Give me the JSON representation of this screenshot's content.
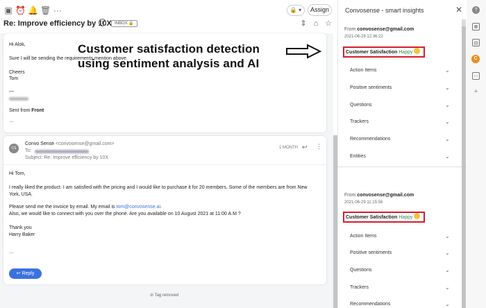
{
  "toolbar": {
    "lock_label": "🔒 ▾",
    "assign_label": "Assign"
  },
  "conversation": {
    "subject": "Re: Improve efficiency by 10X",
    "inbox_tag": "INBOX 🔒"
  },
  "message1": {
    "greeting": "Hi Alok,",
    "body": "Sure I will be sending the requirements mention above.",
    "closing": "Cheers",
    "name": "Tom",
    "separator": "—",
    "sent_from_prefix": "Sent from ",
    "sent_from_app": "Front",
    "ellipsis": "…"
  },
  "overlay": {
    "line1": "Customer satisfaction detection",
    "line2": "using sentiment analysis and AI"
  },
  "message2": {
    "avatar_initials": "CS",
    "sender_name": "Convo Sense",
    "sender_email": "<convosense@gmail.com>",
    "to_label": "To:",
    "subject_label": "Subject:",
    "subject": "Re: Improve efficiency by 10X",
    "time": "1 MONTH",
    "greeting": "Hi Tom,",
    "para1_line1": "I really liked the product. I am satisfied with the pricing and I would like to purchase it for 20 members. Some of the members are from New",
    "para1_line2": "York, USA.",
    "para2_line1_prefix": "Please send me the invoice by email. My email is ",
    "para2_email": "tom@convosense.ai",
    "para2_line1_suffix": ".",
    "para2_line2": "Also, we would like to connect with you over the phone. Are you available on 10 August 2021 at 11:00 A.M ?",
    "closing": "Thank you",
    "name": "Harry Baker",
    "ellipsis": "…",
    "reply_label": "Reply"
  },
  "tag_removed": "Tag removed",
  "insights": {
    "title": "Convosense - smart insights",
    "entries": [
      {
        "from_label": "From ",
        "from_email": "convosense@gmail.com",
        "date": "2021-06-29 12:36:22",
        "satisfaction_label": "Customer Satisfaction",
        "satisfaction_value": "Happy",
        "sections": [
          "Action Items",
          "Positive sentiments",
          "Questions",
          "Trackers",
          "Recommendations",
          "Entities"
        ]
      },
      {
        "from_label": "From ",
        "from_email": "convosense@gmail.com",
        "date": "2021-06-29 11:15:56",
        "satisfaction_label": "Customer Satisfaction",
        "satisfaction_value": "Happy",
        "sections": [
          "Action Items",
          "Positive sentiments",
          "Questions",
          "Trackers",
          "Recommendations"
        ]
      }
    ]
  },
  "rail": {
    "avatar_letter": "C"
  },
  "colors": {
    "accent": "#3b72e0",
    "highlight_border": "#d81b2c",
    "happy": "#2e8b57",
    "rail_avatar": "#ee8a1d"
  }
}
